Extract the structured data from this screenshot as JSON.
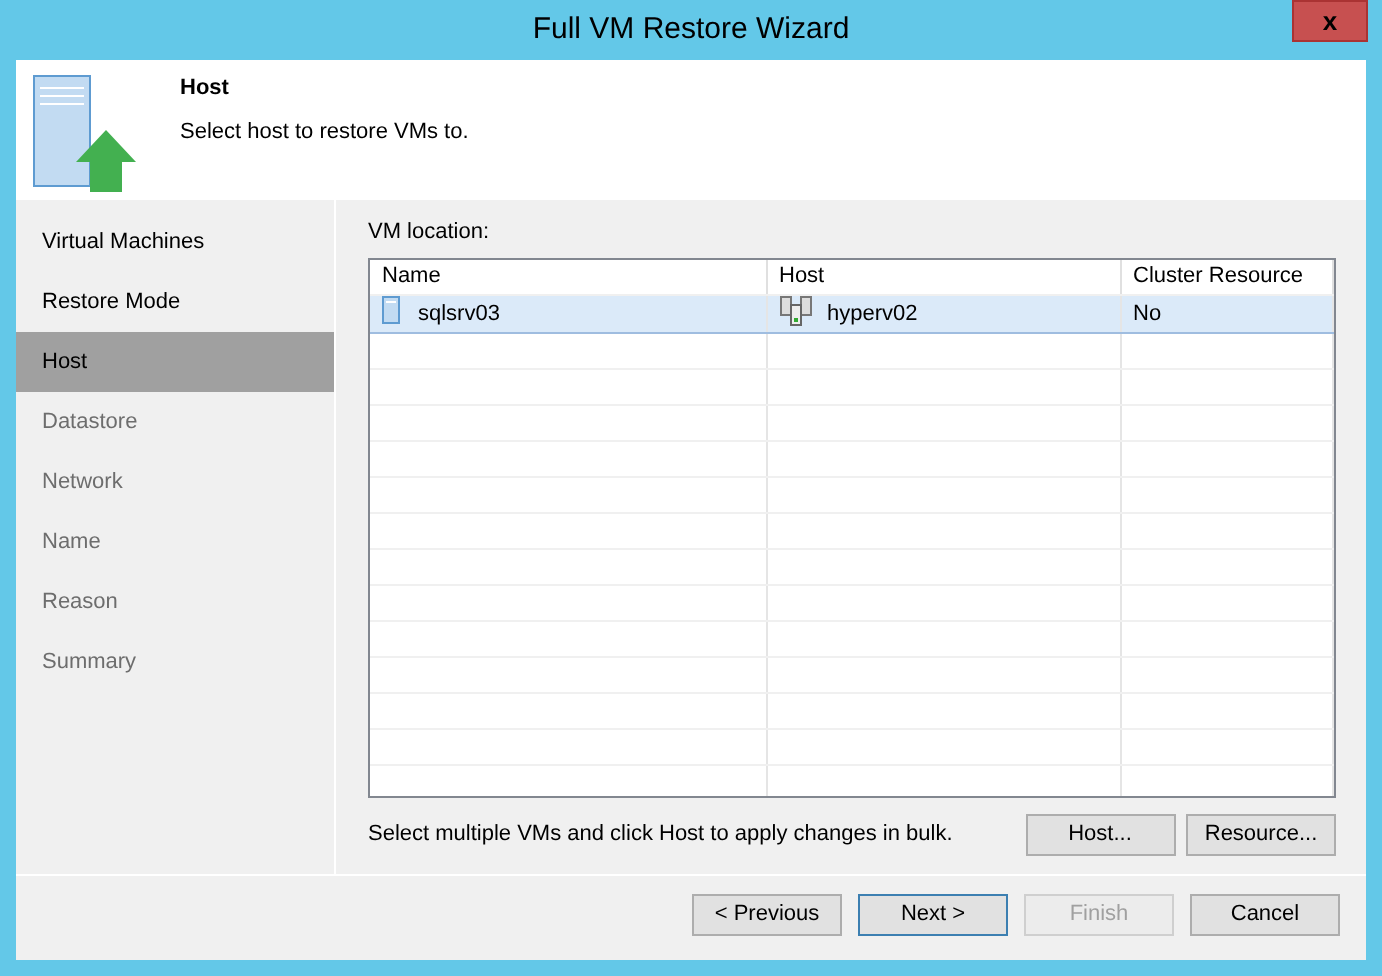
{
  "window": {
    "title": "Full VM Restore Wizard",
    "close": "x"
  },
  "header": {
    "title": "Host",
    "subtitle": "Select host to restore VMs to."
  },
  "steps": [
    {
      "label": "Virtual Machines",
      "selected": false,
      "disabled": false
    },
    {
      "label": "Restore Mode",
      "selected": false,
      "disabled": false
    },
    {
      "label": "Host",
      "selected": true,
      "disabled": false
    },
    {
      "label": "Datastore",
      "selected": false,
      "disabled": true
    },
    {
      "label": "Network",
      "selected": false,
      "disabled": true
    },
    {
      "label": "Name",
      "selected": false,
      "disabled": true
    },
    {
      "label": "Reason",
      "selected": false,
      "disabled": true
    },
    {
      "label": "Summary",
      "selected": false,
      "disabled": true
    }
  ],
  "vm_location": {
    "label": "VM location:",
    "columns": [
      "Name",
      "Host",
      "Cluster Resource"
    ],
    "rows": [
      {
        "name": "sqlsrv03",
        "host": "hyperv02",
        "cluster_resource": "No",
        "selected": true
      }
    ]
  },
  "bulk_hint": "Select multiple VMs and click Host to apply changes in bulk.",
  "bulk_buttons": [
    "Host...",
    "Resource..."
  ],
  "buttons": [
    {
      "label": "< Previous",
      "default": false,
      "disabled": false
    },
    {
      "label": "Next >",
      "default": true,
      "disabled": false
    },
    {
      "label": "Finish",
      "default": false,
      "disabled": true
    },
    {
      "label": "Cancel",
      "default": false,
      "disabled": false
    }
  ]
}
